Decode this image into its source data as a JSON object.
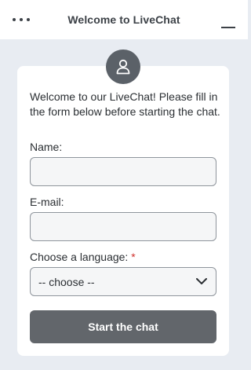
{
  "header": {
    "title": "Welcome to LiveChat",
    "menu_icon": "more-horizontal-icon",
    "minimize_icon": "minimize-icon"
  },
  "form": {
    "avatar_icon": "user-icon",
    "intro": "Welcome to our LiveChat! Please fill in the form below before starting the chat.",
    "name_label": "Name:",
    "name_value": "",
    "email_label": "E-mail:",
    "email_value": "",
    "language_label": "Choose a language:",
    "required_marker": "*",
    "language_selected": "-- choose --",
    "submit_label": "Start the chat"
  },
  "colors": {
    "background": "#e8ecf2",
    "button": "#62666b",
    "avatar": "#5b6168",
    "required": "#d0312d"
  }
}
